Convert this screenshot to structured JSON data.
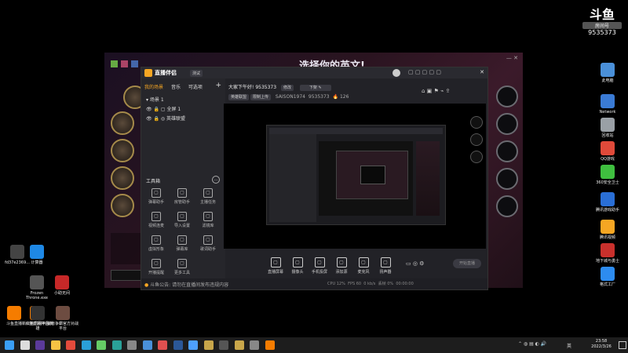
{
  "desktop": {
    "watermark": {
      "brand": "斗鱼",
      "room_label": "房间号",
      "room_number": "9535373"
    },
    "right_icons": [
      {
        "label": "此电脑",
        "icon": "computer-icon",
        "color": "#4a90d9"
      },
      {
        "label": "Network",
        "icon": "network-icon",
        "color": "#3a7bd5"
      },
      {
        "label": "回收站",
        "icon": "recycle-bin-icon",
        "color": "#9aa0a6"
      },
      {
        "label": "QQ游戏",
        "icon": "qq-game-icon",
        "color": "#e04a3a"
      },
      {
        "label": "360安全卫士",
        "icon": "shield-icon",
        "color": "#3fbf3f"
      },
      {
        "label": "腾讯游戏助手",
        "icon": "game-assistant-icon",
        "color": "#2a6fd6"
      },
      {
        "label": "腾讯视频",
        "icon": "video-icon",
        "color": "#f5a623"
      },
      {
        "label": "地下城与勇士",
        "icon": "dnf-icon",
        "color": "#c9302c"
      },
      {
        "label": "格式工厂",
        "icon": "format-factory-icon",
        "color": "#2d8cf0"
      }
    ],
    "left_icons": [
      {
        "label": "fd37e2369...",
        "icon": "file-icon",
        "color": "#444"
      },
      {
        "label": "计算器",
        "icon": "calculator-icon",
        "color": "#1e88e5"
      },
      {
        "label": "Frozen Throne.exe",
        "icon": "warcraft-icon",
        "color": "#555"
      },
      {
        "label": "小助无间",
        "icon": "app-icon",
        "color": "#c62828"
      },
      {
        "label": "斗鱼直播",
        "icon": "douyu-icon",
        "color": "#f57c00"
      },
      {
        "label": "斗鱼直播伴侣",
        "icon": "douyu-companion-icon",
        "color": "#f57c00"
      },
      {
        "label": "新红猫讯网平台英雄",
        "icon": "app-icon",
        "color": "#333"
      },
      {
        "label": "魔兽争霸官方对战平台",
        "icon": "battle-platform-icon",
        "color": "#6d4c41"
      }
    ]
  },
  "game": {
    "title": "选择你的英文!",
    "colors": {
      "gold": "#a58a4a"
    }
  },
  "streamer": {
    "app_name": "直播伴侣",
    "version_badge": "测试",
    "tabs": [
      "我的场景",
      "音乐",
      "可选项"
    ],
    "scene_group": "场景 1",
    "sources": [
      {
        "label": "全屏 1"
      },
      {
        "label": "英雄联盟"
      }
    ],
    "tools_title": "工具箱",
    "tools": [
      {
        "label": "弹幕助手",
        "icon": "danmaku-icon"
      },
      {
        "label": "房管助手",
        "icon": "admin-icon"
      },
      {
        "label": "主播任务",
        "icon": "task-icon"
      },
      {
        "label": "视频连麦",
        "icon": "video-link-icon"
      },
      {
        "label": "导入设置",
        "icon": "import-icon"
      },
      {
        "label": "滤镜库",
        "icon": "filter-icon"
      },
      {
        "label": "虚拟形象",
        "icon": "avatar-icon"
      },
      {
        "label": "弹幕库",
        "icon": "library-icon"
      },
      {
        "label": "歌词助手",
        "icon": "lyrics-icon"
      },
      {
        "label": "开播提醒",
        "icon": "notice-icon"
      },
      {
        "label": "更多工具",
        "icon": "more-icon"
      }
    ],
    "header": {
      "greeting": "大家下午好!",
      "room_id": "9535373",
      "edit_label": "修改",
      "dropdown": "下架",
      "category_tag": "英雄联盟",
      "rank_tag": "限制上传",
      "user_id": "SAISON1974",
      "room_id_2": "9535373",
      "hot": "126"
    },
    "controls": [
      {
        "label": "直播屏幕",
        "icon": "screen-icon"
      },
      {
        "label": "摄像头",
        "icon": "camera-icon"
      },
      {
        "label": "手机投屏",
        "icon": "phone-icon"
      },
      {
        "label": "添加源",
        "icon": "add-source-icon"
      },
      {
        "label": "麦克风",
        "icon": "mic-icon"
      },
      {
        "label": "扬声器",
        "icon": "speaker-icon"
      }
    ],
    "start_button": "开始直播",
    "status_bar": {
      "notice": "斗鱼公告: 请勿在直播间发布违规内容",
      "cpu": "CPU 12%",
      "fps": "FPS 60",
      "bitrate": "0 kb/s",
      "drop": "丢帧 0%",
      "duration": "00:00:00"
    },
    "colors": {
      "accent": "#f5a623",
      "start": "#3a3a42"
    }
  },
  "taskbar": {
    "time": "23:58",
    "date": "2022/3/26",
    "language": "英",
    "apps": [
      {
        "icon": "windows-start-icon",
        "color": "#3a9ff5"
      },
      {
        "icon": "search-icon",
        "color": "#ddd"
      },
      {
        "icon": "premiere-icon",
        "color": "#5b3a9b"
      },
      {
        "icon": "file-explorer-icon",
        "color": "#f6c244"
      },
      {
        "icon": "chrome-icon",
        "color": "#e34b3c"
      },
      {
        "icon": "edge-icon",
        "color": "#2aa0d8"
      },
      {
        "icon": "app-icon",
        "color": "#6c6"
      },
      {
        "icon": "app-icon",
        "color": "#2aa198"
      },
      {
        "icon": "game-icon",
        "color": "#888"
      },
      {
        "icon": "mail-icon",
        "color": "#4a90d9"
      },
      {
        "icon": "app-icon",
        "color": "#e05050"
      },
      {
        "icon": "word-icon",
        "color": "#2b5797"
      },
      {
        "icon": "download-icon",
        "color": "#4ea0ff"
      },
      {
        "icon": "league-icon",
        "color": "#c8a64a"
      },
      {
        "icon": "game-icon",
        "color": "#555"
      },
      {
        "icon": "folder-icon",
        "color": "#c8a64a"
      },
      {
        "icon": "app-icon",
        "color": "#888"
      },
      {
        "icon": "douyu-icon",
        "color": "#f57c00"
      }
    ]
  }
}
